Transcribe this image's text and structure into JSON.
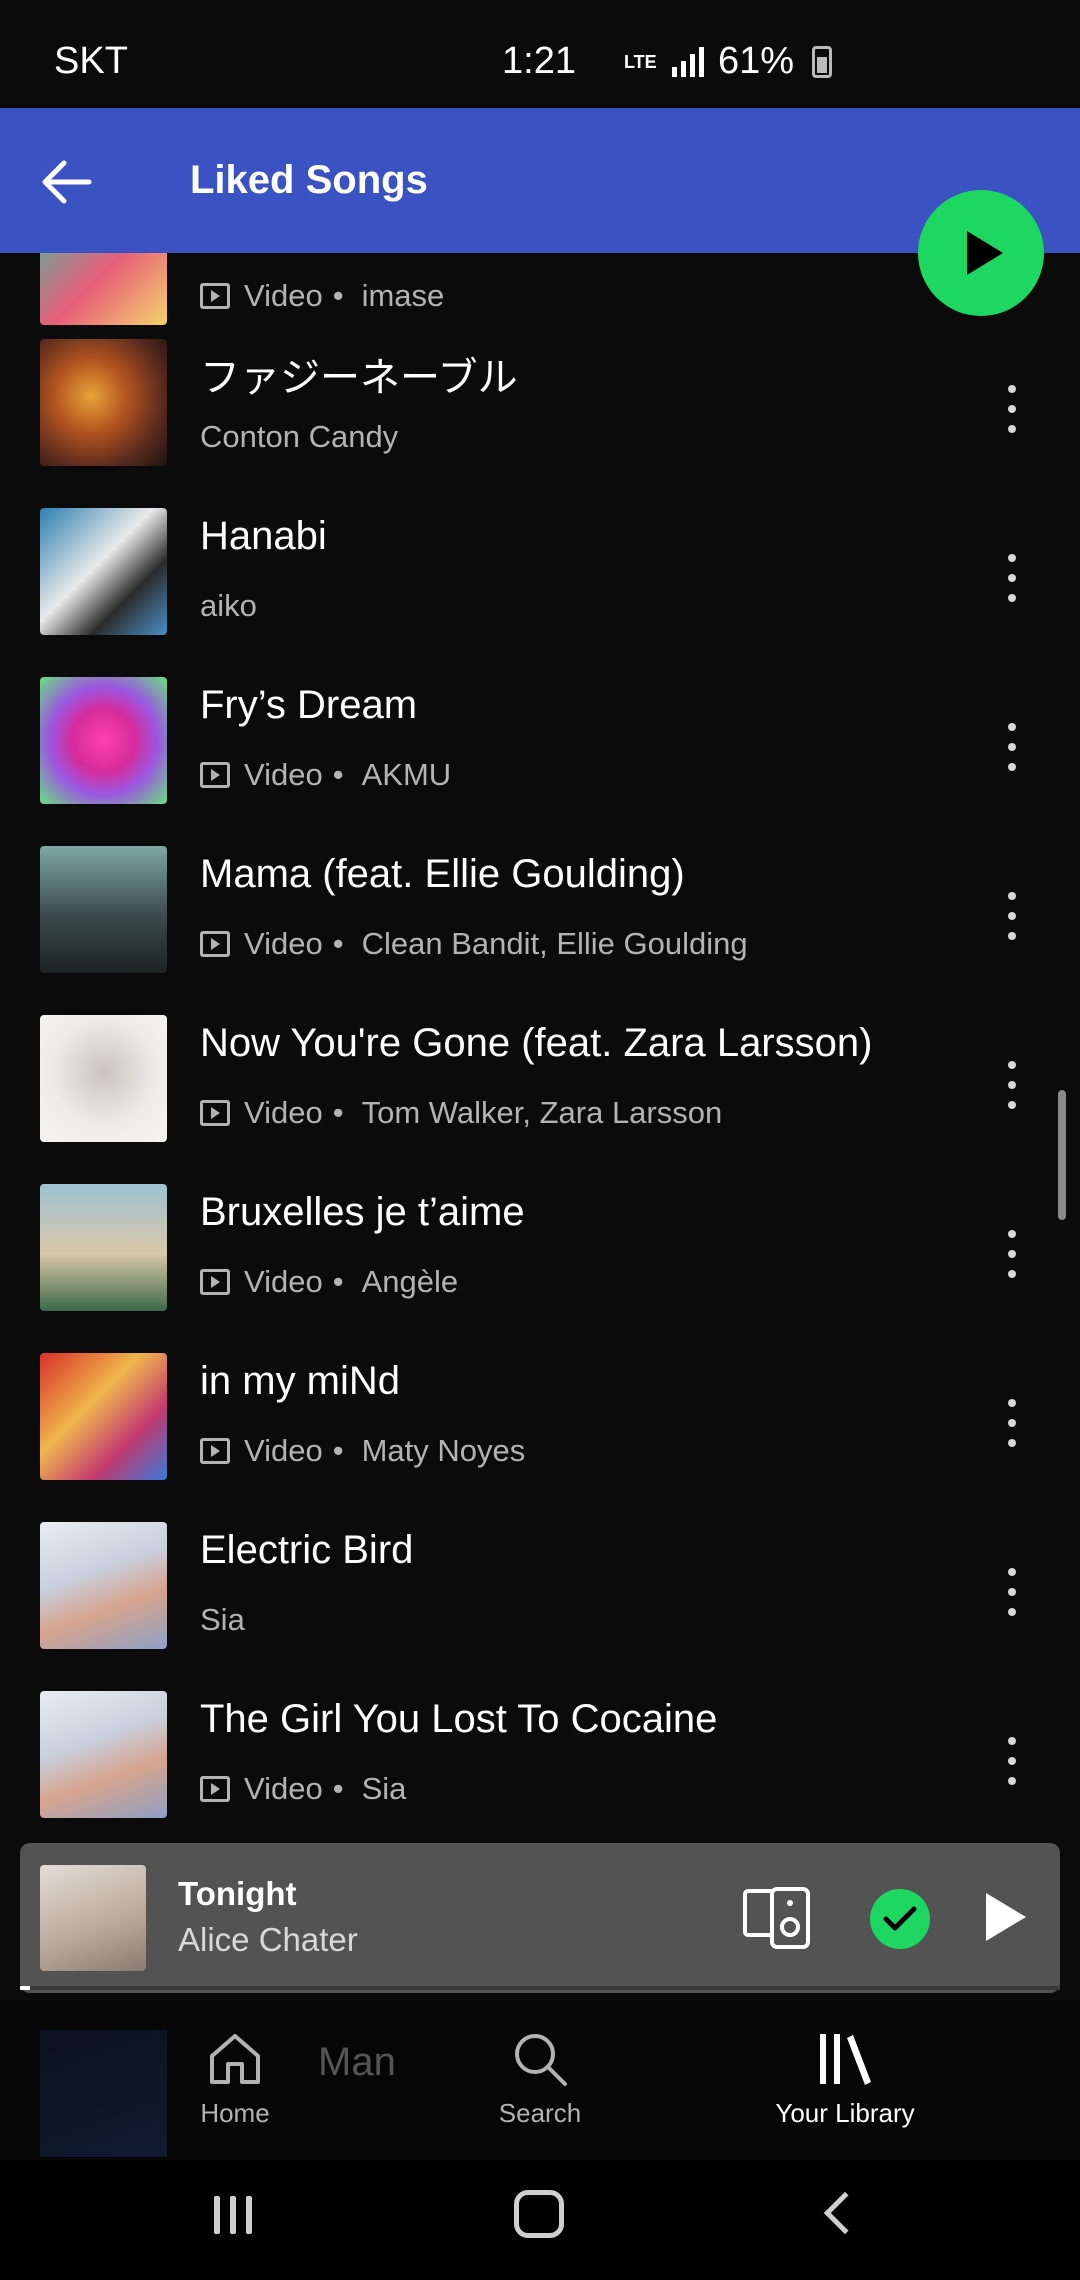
{
  "status_bar": {
    "carrier": "SKT",
    "time": "1:21",
    "network": "LTE",
    "battery": "61%"
  },
  "header": {
    "title": "Liked Songs"
  },
  "songs": [
    {
      "title": "",
      "video_label": "Video",
      "artist": "imase",
      "is_video": true
    },
    {
      "title": "ファジーネーブル",
      "video_label": "",
      "artist": "Conton Candy",
      "is_video": false
    },
    {
      "title": "Hanabi",
      "video_label": "",
      "artist": "aiko",
      "is_video": false
    },
    {
      "title": "Fry’s Dream",
      "video_label": "Video",
      "artist": "AKMU",
      "is_video": true
    },
    {
      "title": "Mama (feat. Ellie Goulding)",
      "video_label": "Video",
      "artist": "Clean Bandit, Ellie Goulding",
      "is_video": true
    },
    {
      "title": "Now You're Gone (feat. Zara Larsson)",
      "video_label": "Video",
      "artist": "Tom Walker, Zara Larsson",
      "is_video": true
    },
    {
      "title": "Bruxelles je t’aime",
      "video_label": "Video",
      "artist": "Angèle",
      "is_video": true
    },
    {
      "title": "in my miNd",
      "video_label": "Video",
      "artist": "Maty Noyes",
      "is_video": true
    },
    {
      "title": "Electric Bird",
      "video_label": "",
      "artist": "Sia",
      "is_video": false
    },
    {
      "title": "The Girl You Lost To Cocaine",
      "video_label": "Video",
      "artist": "Sia",
      "is_video": true
    }
  ],
  "mini_player": {
    "title": "Tonight",
    "artist": "Alice Chater",
    "progress": 0.01
  },
  "partial_row_title": "Man",
  "nav": {
    "home": "Home",
    "search": "Search",
    "library": "Your Library"
  },
  "colors": {
    "accent": "#1ed760",
    "header": "#3a52c2",
    "background": "#0b0b0c"
  }
}
